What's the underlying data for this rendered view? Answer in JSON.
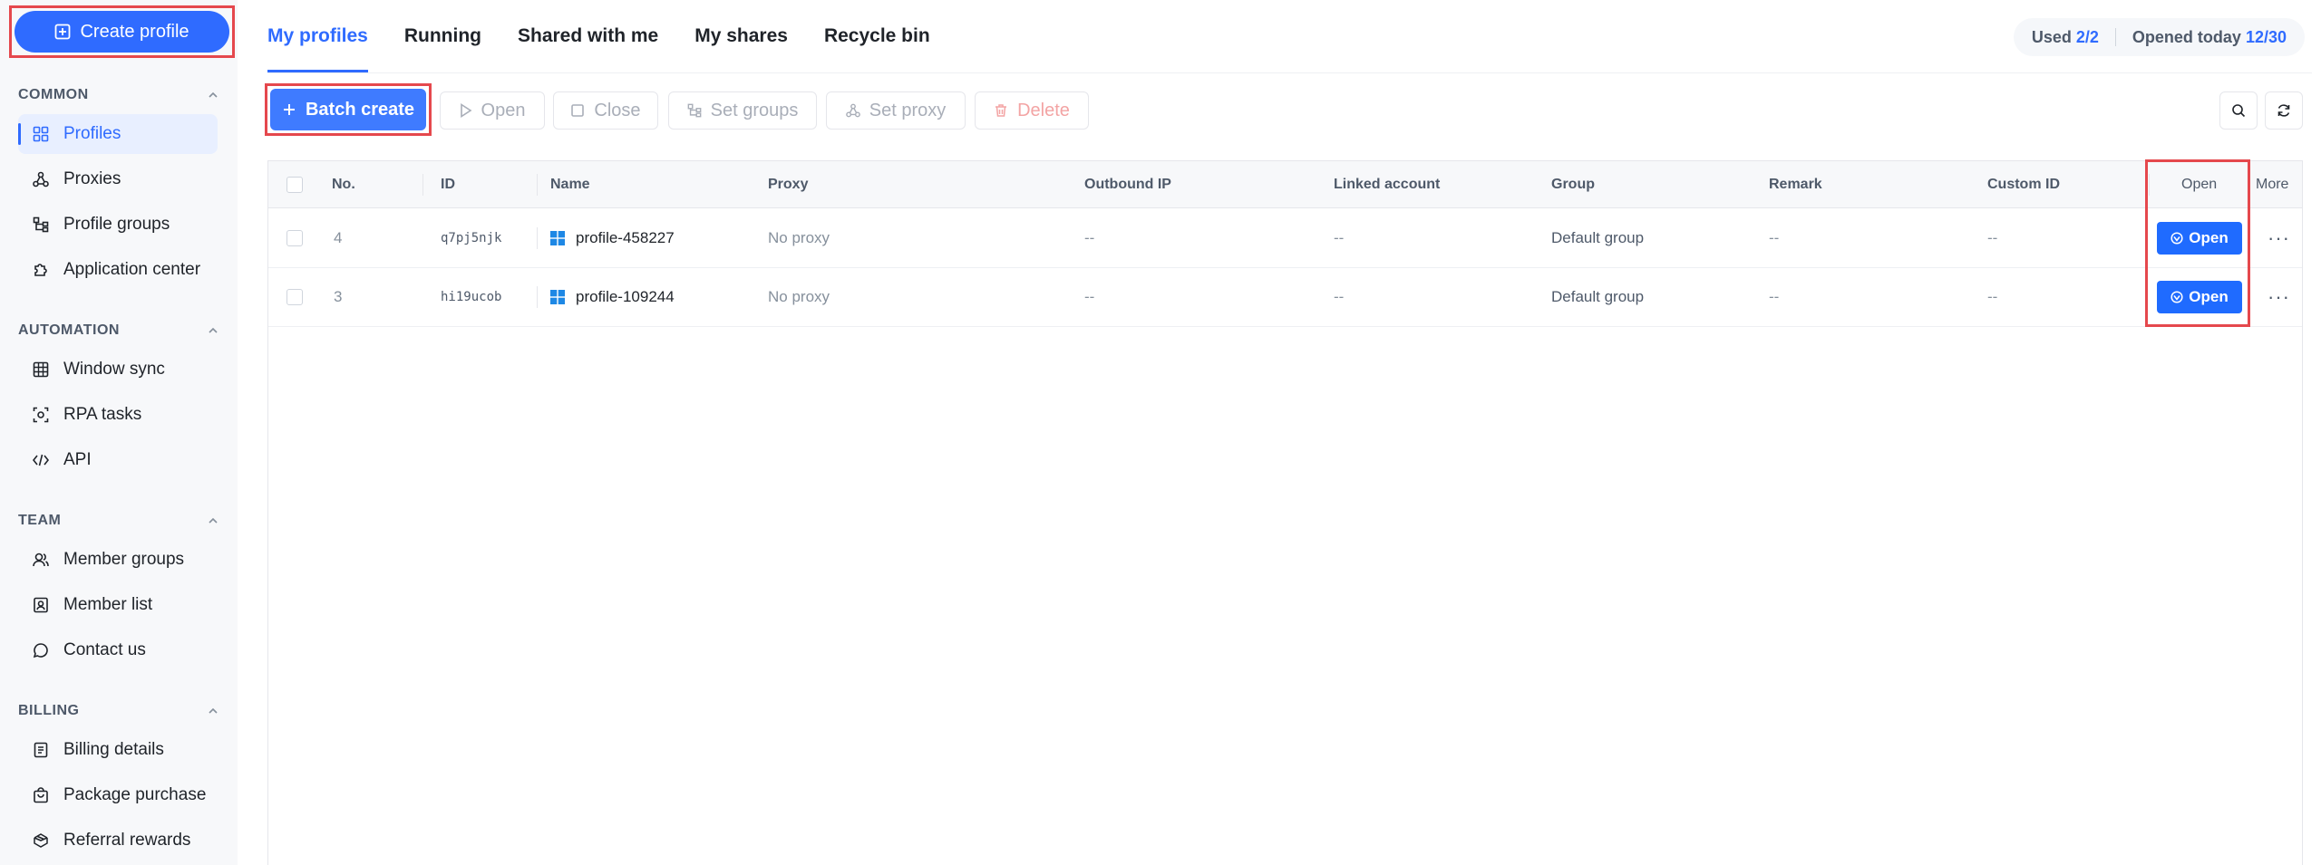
{
  "sidebar": {
    "create_label": "Create profile",
    "sections": [
      {
        "title": "COMMON",
        "items": [
          {
            "label": "Profiles",
            "icon": "grid-icon",
            "active": true
          },
          {
            "label": "Proxies",
            "icon": "network-icon"
          },
          {
            "label": "Profile groups",
            "icon": "tree-icon"
          },
          {
            "label": "Application center",
            "icon": "puzzle-icon"
          }
        ]
      },
      {
        "title": "AUTOMATION",
        "items": [
          {
            "label": "Window sync",
            "icon": "window-grid-icon"
          },
          {
            "label": "RPA tasks",
            "icon": "rpa-icon"
          },
          {
            "label": "API",
            "icon": "code-icon"
          }
        ]
      },
      {
        "title": "TEAM",
        "items": [
          {
            "label": "Member groups",
            "icon": "users-icon"
          },
          {
            "label": "Member list",
            "icon": "contact-card-icon"
          },
          {
            "label": "Contact us",
            "icon": "chat-icon"
          }
        ]
      },
      {
        "title": "BILLING",
        "items": [
          {
            "label": "Billing details",
            "icon": "receipt-icon"
          },
          {
            "label": "Package purchase",
            "icon": "bag-icon"
          },
          {
            "label": "Referral rewards",
            "icon": "gift-icon"
          }
        ]
      }
    ]
  },
  "tabs": [
    {
      "label": "My profiles",
      "active": true
    },
    {
      "label": "Running"
    },
    {
      "label": "Shared with me"
    },
    {
      "label": "My shares"
    },
    {
      "label": "Recycle bin"
    }
  ],
  "usage": {
    "used_label": "Used",
    "used_value": "2/2",
    "opened_label": "Opened today",
    "opened_value": "12/30"
  },
  "toolbar": {
    "batch_create": "Batch create",
    "open": "Open",
    "close": "Close",
    "set_groups": "Set groups",
    "set_proxy": "Set proxy",
    "delete": "Delete"
  },
  "table": {
    "headers": {
      "no": "No.",
      "id": "ID",
      "name": "Name",
      "proxy": "Proxy",
      "outbound_ip": "Outbound IP",
      "linked_account": "Linked account",
      "group": "Group",
      "remark": "Remark",
      "custom_id": "Custom ID",
      "open": "Open",
      "more": "More"
    },
    "rows": [
      {
        "no": "4",
        "id": "q7pj5njk",
        "name": "profile-458227",
        "proxy": "No proxy",
        "outbound_ip": "--",
        "linked_account": "--",
        "group": "Default group",
        "remark": "--",
        "custom_id": "--",
        "open": "Open",
        "more": "···"
      },
      {
        "no": "3",
        "id": "hi19ucob",
        "name": "profile-109244",
        "proxy": "No proxy",
        "outbound_ip": "--",
        "linked_account": "--",
        "group": "Default group",
        "remark": "--",
        "custom_id": "--",
        "open": "Open",
        "more": "···"
      }
    ]
  },
  "colors": {
    "accent": "#2f6bff",
    "highlight": "#e5484d",
    "danger_text": "#f3a4a4"
  }
}
